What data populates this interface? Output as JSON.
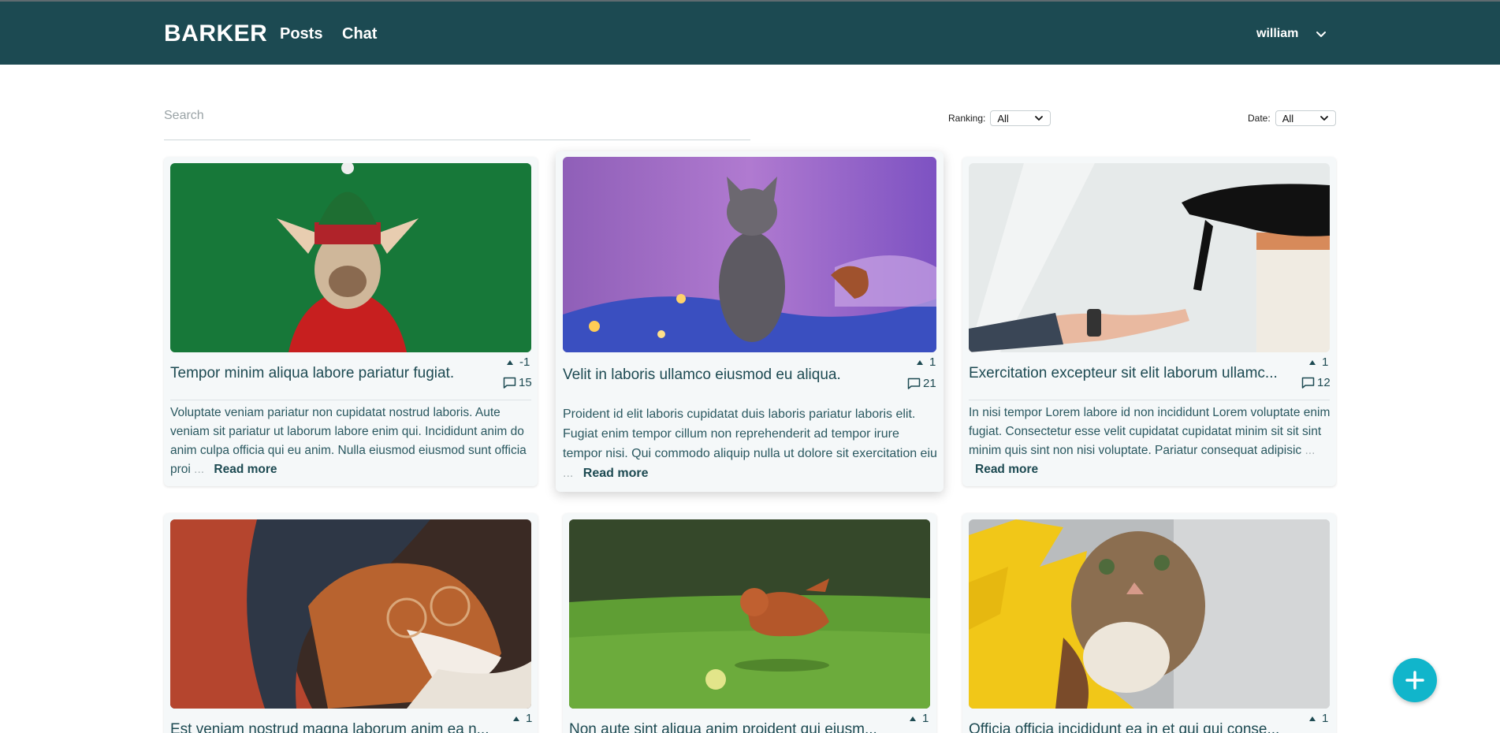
{
  "nav": {
    "brand": "BARKER",
    "links": [
      "Posts",
      "Chat"
    ],
    "user": "william"
  },
  "search": {
    "placeholder": "Search"
  },
  "filters": {
    "ranking_label": "Ranking:",
    "ranking_value": "All",
    "date_label": "Date:",
    "date_value": "All"
  },
  "posts": [
    {
      "title": "Tempor minim aliqua labore pariatur fugiat.",
      "score": "-1",
      "comments": "15",
      "excerpt": "Voluptate veniam pariatur non cupidatat nostrud laboris. Aute veniam sit pariatur ut laborum labore enim qui. Incididunt anim do anim culpa officia qui eu anim. Nulla eiusmod eiusmod sunt officia proi",
      "ellipsis": "...",
      "read_more": "Read more",
      "image": "elf-dog"
    },
    {
      "title": "Velit in laboris ullamco eiusmod eu aliqua.",
      "score": "1",
      "comments": "21",
      "excerpt": "Proident id elit laboris cupidatat duis laboris pariatur laboris elit. Fugiat enim tempor cillum non reprehenderit ad tempor irure tempor nisi. Qui commodo aliquip nulla ut dolore sit exercitation eiu",
      "ellipsis": "...",
      "read_more": "Read more",
      "image": "cat-on-blanket"
    },
    {
      "title": "Exercitation excepteur sit elit laborum ullamc...",
      "score": "1",
      "comments": "12",
      "excerpt": "In nisi tempor Lorem labore id non incididunt Lorem voluptate enim fugiat. Consectetur esse velit cupidatat cupidatat minim sit sit sint minim quis sint non nisi voluptate. Pariatur consequat adipisic",
      "ellipsis": "...",
      "read_more": "Read more",
      "image": "black-cat-hand"
    },
    {
      "title": "Est veniam nostrud magna laborum anim ea n...",
      "score": "1",
      "image": "dog-glasses"
    },
    {
      "title": "Non aute sint aliqua anim proident qui eiusm...",
      "score": "1",
      "image": "poodle-ball"
    },
    {
      "title": "Officia officia incididunt ea in et qui qui conse...",
      "score": "1",
      "image": "sunflower-cat"
    }
  ],
  "fab": {
    "icon": "plus-icon"
  },
  "colors": {
    "navbar": "#1c4a52",
    "fab": "#11b5cb",
    "text": "#1d4a52"
  }
}
